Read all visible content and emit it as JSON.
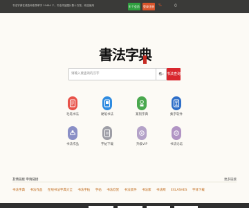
{
  "topbar": {
    "notice": "书法字典在线查询收录单字 19464 个，书法作品图片数十万张，欢迎使用",
    "badge_green": "8 个会员",
    "pill_orange": "登录注册",
    "mark": "%",
    "count": "0"
  },
  "logo": {
    "text": "書法字典",
    "seal": "书法字典"
  },
  "search": {
    "placeholder": "请输入要查询的汉字",
    "mode": "楷",
    "button": "书法查询"
  },
  "tiles": [
    {
      "label": "毛笔书法",
      "color": "#e8534a",
      "icon": "brush-icon"
    },
    {
      "label": "硬笔书法",
      "color": "#2f8be0",
      "icon": "pen-icon"
    },
    {
      "label": "篆刻字典",
      "color": "#4aa84e",
      "icon": "seal-icon"
    },
    {
      "label": "集字软件",
      "color": "#2f6fc8",
      "icon": "collect-icon"
    },
    {
      "label": "书法作品",
      "color": "#8a8fc6",
      "icon": "work-icon"
    },
    {
      "label": "字帖下载",
      "color": "#9e9ea6",
      "icon": "download-icon"
    },
    {
      "label": "升级VIP",
      "color": "#b4a2c8",
      "icon": "vip-icon"
    },
    {
      "label": "书法论坛",
      "color": "#b194c4",
      "icon": "forum-icon"
    }
  ],
  "links": {
    "head": "友情链接 申请链接",
    "more": "更多链接",
    "items": [
      "书法字典",
      "书法作品",
      "在线书法字典大全",
      "书法字帖",
      "字帖",
      "书法欣赏",
      "书法软件",
      "书法家",
      "书法网",
      "EXLASHES",
      "字体下载"
    ]
  }
}
